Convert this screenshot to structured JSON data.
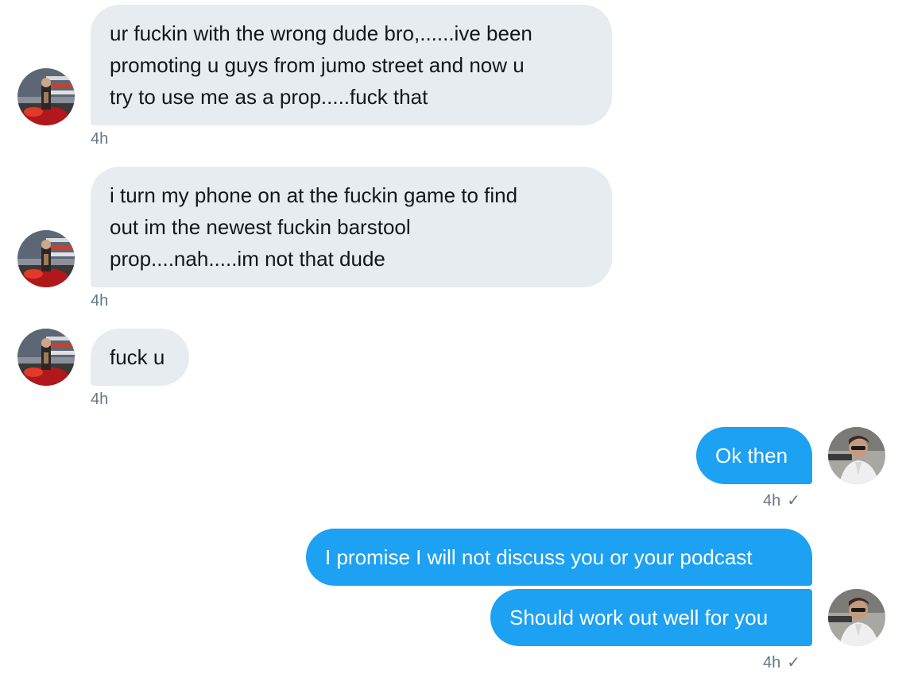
{
  "conversation": {
    "messages": [
      {
        "lines": [
          "ur fuckin with the wrong dude bro,......ive been",
          "promoting u guys from jumo street and now u",
          "try to use me as a prop.....fuck that"
        ],
        "time": "4h"
      },
      {
        "lines": [
          "i turn my phone on at the fuckin game to find",
          "out im the newest fuckin barstool",
          "prop....nah.....im not that dude"
        ],
        "time": "4h"
      },
      {
        "lines": [
          "fuck u"
        ],
        "time": "4h"
      },
      {
        "lines": [
          "Ok then"
        ],
        "time": "4h",
        "status_icon": "checkmark-icon"
      },
      {
        "lines": [
          "I promise I will not discuss you or your podcast"
        ]
      },
      {
        "lines": [
          "Should work out well for you"
        ],
        "time": "4h",
        "status_icon": "checkmark-icon"
      }
    ]
  },
  "colors": {
    "incoming_bubble": "#e6ecf0",
    "incoming_text": "#14171a",
    "outgoing_bubble": "#1da1f2",
    "outgoing_text": "#ffffff",
    "timestamp": "#657786"
  },
  "icons": {
    "sender_avatar": "sender-avatar",
    "self_avatar": "self-avatar",
    "read_receipt": "checkmark-icon"
  }
}
